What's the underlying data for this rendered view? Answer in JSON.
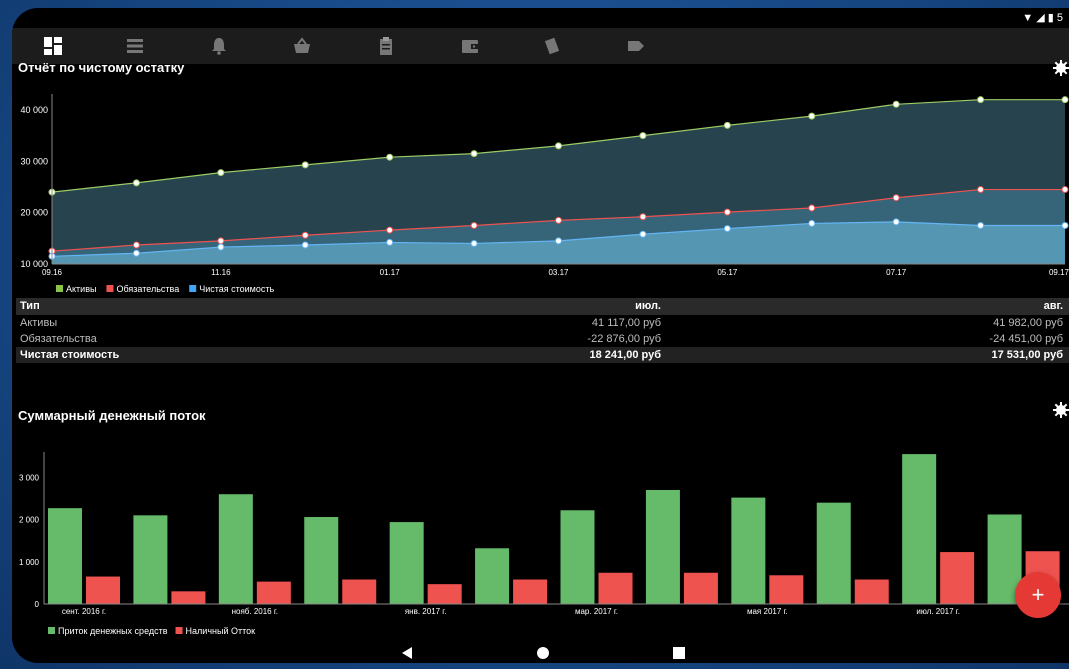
{
  "status": {
    "icons": [
      "wifi-icon",
      "signal-icon",
      "battery-icon"
    ],
    "text": "5"
  },
  "tabs": [
    {
      "name": "dashboard",
      "icon": "dashboard-icon",
      "active": true
    },
    {
      "name": "list",
      "icon": "list-icon"
    },
    {
      "name": "reminders",
      "icon": "bell-icon"
    },
    {
      "name": "purchases",
      "icon": "basket-icon"
    },
    {
      "name": "reports",
      "icon": "clipboard-icon"
    },
    {
      "name": "wallet",
      "icon": "wallet-icon"
    },
    {
      "name": "cards",
      "icon": "cards-icon"
    },
    {
      "name": "tags",
      "icon": "tag-icon"
    }
  ],
  "net_report": {
    "title": "Отчёт по чистому остатку",
    "table": {
      "header": [
        "Тип",
        "июл.",
        "авг."
      ],
      "rows": [
        [
          "Активы",
          "41 117,00 руб",
          "41 982,00 руб"
        ],
        [
          "Обязательства",
          "-22 876,00 руб",
          "-24 451,00 руб"
        ]
      ],
      "total": [
        "Чистая стоимость",
        "18 241,00 руб",
        "17 531,00 руб"
      ]
    }
  },
  "cash_flow": {
    "title": "Суммарный денежный поток"
  },
  "colors": {
    "green": "#8bc34a",
    "red": "#ef5350",
    "blue": "#42a5f5",
    "fab": "#e53935"
  },
  "chart_data": [
    {
      "type": "area",
      "title": "Отчёт по чистому остатку",
      "x": [
        "09.16",
        "10.16",
        "11.16",
        "12.16",
        "01.17",
        "02.17",
        "03.17",
        "04.17",
        "05.17",
        "06.17",
        "07.17",
        "08.17",
        "09.17"
      ],
      "x_tick_labels": [
        "09.16",
        "11.16",
        "01.17",
        "03.17",
        "05.17",
        "07.17",
        "09.17"
      ],
      "y_ticks": [
        10000,
        20000,
        30000,
        40000
      ],
      "y_tick_labels": [
        "10 000",
        "20 000",
        "30 000",
        "40 000"
      ],
      "ylim": [
        10000,
        47000
      ],
      "legend": "bottom-left",
      "series": [
        {
          "name": "Активы",
          "color": "#8bc34a",
          "values": [
            24000,
            25800,
            27800,
            29300,
            30800,
            31500,
            33000,
            35000,
            37000,
            38800,
            41100,
            42000,
            42000
          ]
        },
        {
          "name": "Обязательства",
          "color": "#ef5350",
          "values": [
            12500,
            13700,
            14500,
            15600,
            16600,
            17500,
            18500,
            19200,
            20100,
            20900,
            22900,
            24500,
            24500
          ]
        },
        {
          "name": "Чистая стоимость",
          "color": "#42a5f5",
          "values": [
            11500,
            12100,
            13300,
            13700,
            14200,
            14000,
            14500,
            15800,
            16900,
            17900,
            18200,
            17500,
            17500
          ]
        }
      ]
    },
    {
      "type": "bar",
      "title": "Суммарный денежный поток",
      "categories": [
        "сент. 2016 г.",
        "окт. 2016 г.",
        "нояб. 2016 г.",
        "дек. 2016 г.",
        "янв. 2017 г.",
        "февр. 2017 г.",
        "мар. 2017 г.",
        "апр. 2017 г.",
        "мая 2017 г.",
        "июн. 2017 г.",
        "июл. 2017 г.",
        "авг. 2017 г."
      ],
      "x_tick_labels": [
        "сент. 2016 г.",
        "нояб. 2016 г.",
        "янв. 2017 г.",
        "мар. 2017 г.",
        "мая 2017 г.",
        "июл. 2017 г."
      ],
      "y_ticks": [
        0,
        1000,
        2000,
        3000
      ],
      "y_tick_labels": [
        "0",
        "1 000",
        "2 000",
        "3 000"
      ],
      "ylim": [
        0,
        3600
      ],
      "legend": "bottom-left",
      "series": [
        {
          "name": "Приток денежных средств",
          "color": "#66bb6a",
          "values": [
            2270,
            2100,
            2600,
            2060,
            1940,
            1320,
            2220,
            2700,
            2520,
            2400,
            3550,
            2120
          ]
        },
        {
          "name": "Наличный Отток",
          "color": "#ef5350",
          "values": [
            650,
            300,
            530,
            580,
            470,
            580,
            740,
            740,
            680,
            580,
            1230,
            1250
          ]
        }
      ]
    }
  ]
}
